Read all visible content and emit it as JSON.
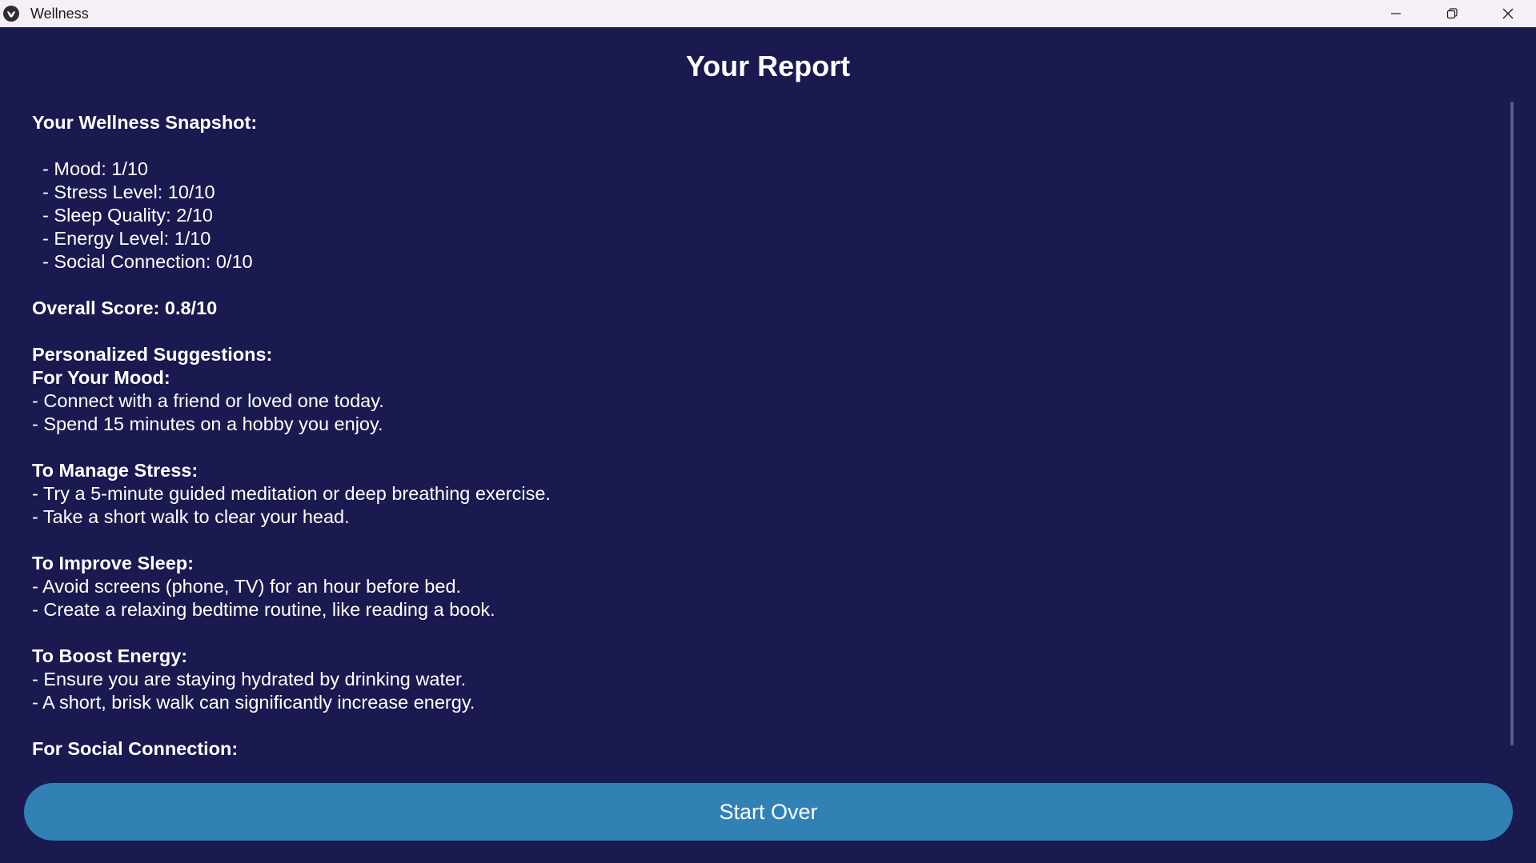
{
  "window": {
    "title": "Wellness",
    "app_icon": "wellness-app-icon",
    "controls": [
      "minimize-icon",
      "restore-icon",
      "close-icon"
    ]
  },
  "page": {
    "title": "Your Report"
  },
  "report": {
    "snapshot_heading": "Your Wellness Snapshot:",
    "metrics": [
      "  - Mood: 1/10",
      "  - Stress Level: 10/10",
      "  - Sleep Quality: 2/10",
      "  - Energy Level: 1/10",
      "  - Social Connection: 0/10"
    ],
    "overall_score": "Overall Score: 0.8/10",
    "suggestions_heading": "Personalized Suggestions:",
    "sections": [
      {
        "heading": "For Your Mood:",
        "items": [
          "- Connect with a friend or loved one today.",
          "- Spend 15 minutes on a hobby you enjoy."
        ]
      },
      {
        "heading": "To Manage Stress:",
        "items": [
          "- Try a 5-minute guided meditation or deep breathing exercise.",
          "- Take a short walk to clear your head."
        ]
      },
      {
        "heading": "To Improve Sleep:",
        "items": [
          "- Avoid screens (phone, TV) for an hour before bed.",
          "- Create a relaxing bedtime routine, like reading a book."
        ]
      },
      {
        "heading": "To Boost Energy:",
        "items": [
          "- Ensure you are staying hydrated by drinking water.",
          "- A short, brisk walk can significantly increase energy."
        ]
      },
      {
        "heading": "For Social Connection:",
        "items": []
      }
    ]
  },
  "actions": {
    "start_over_label": "Start Over"
  },
  "colors": {
    "background": "#1a1a50",
    "titlebar": "#f7eff8",
    "button": "#3281b5",
    "text": "#ffffff"
  }
}
